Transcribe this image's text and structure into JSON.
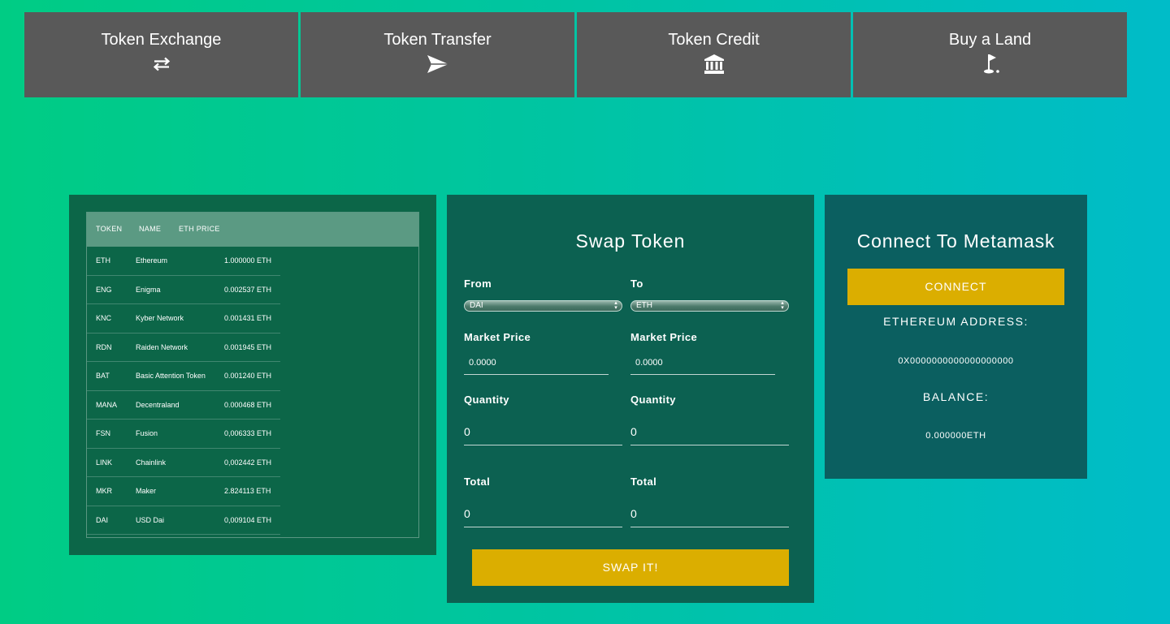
{
  "nav": {
    "tabs": [
      {
        "label": "Token Exchange",
        "icon": "exchange-arrows-icon"
      },
      {
        "label": "Token Transfer",
        "icon": "paper-plane-icon"
      },
      {
        "label": "Token Credit",
        "icon": "bank-icon"
      },
      {
        "label": "Buy a Land",
        "icon": "golf-flag-icon"
      }
    ]
  },
  "token_table": {
    "headers": {
      "token": "TOKEN",
      "name": "NAME",
      "eth_price": "ETH PRICE"
    },
    "rows": [
      {
        "symbol": "ETH",
        "name": "Ethereum",
        "price": "1.000000 ETH"
      },
      {
        "symbol": "ENG",
        "name": "Enigma",
        "price": "0.002537 ETH"
      },
      {
        "symbol": "KNC",
        "name": "Kyber Network",
        "price": "0.001431 ETH"
      },
      {
        "symbol": "RDN",
        "name": "Raiden Network",
        "price": "0.001945 ETH"
      },
      {
        "symbol": "BAT",
        "name": "Basic Attention Token",
        "price": "0.001240 ETH"
      },
      {
        "symbol": "MANA",
        "name": "Decentraland",
        "price": "0.000468 ETH"
      },
      {
        "symbol": "FSN",
        "name": "Fusion",
        "price": "0,006333 ETH"
      },
      {
        "symbol": "LINK",
        "name": "Chainlink",
        "price": "0,002442 ETH"
      },
      {
        "symbol": "MKR",
        "name": "Maker",
        "price": "2.824113 ETH"
      },
      {
        "symbol": "DAI",
        "name": "USD Dai",
        "price": "0,009104 ETH"
      }
    ]
  },
  "swap": {
    "title": "Swap Token",
    "from": {
      "label": "From",
      "selected": "DAI",
      "market_price_label": "Market Price",
      "market_price": "0.0000",
      "quantity_label": "Quantity",
      "quantity": "0",
      "total_label": "Total",
      "total": "0"
    },
    "to": {
      "label": "To",
      "selected": "ETH",
      "market_price_label": "Market Price",
      "market_price": "0.0000",
      "quantity_label": "Quantity",
      "quantity": "0",
      "total_label": "Total",
      "total": "0"
    },
    "button_label": "SWAP IT!"
  },
  "metamask": {
    "title": "Connect To Metamask",
    "connect_label": "CONNECT",
    "address_label": "ETHEREUM ADDRESS:",
    "address": "0X0000000000000000000",
    "balance_label": "BALANCE:",
    "balance": "0.000000ETH"
  },
  "colors": {
    "background_start": "#00cc84",
    "background_end": "#00bcc8",
    "nav_tab": "#595959",
    "table_panel": "#0c6648",
    "table_header": "#5b9a83",
    "swap_panel": "#0c6151",
    "metamask_panel": "#0b5f60",
    "accent_button": "#dbae00"
  }
}
